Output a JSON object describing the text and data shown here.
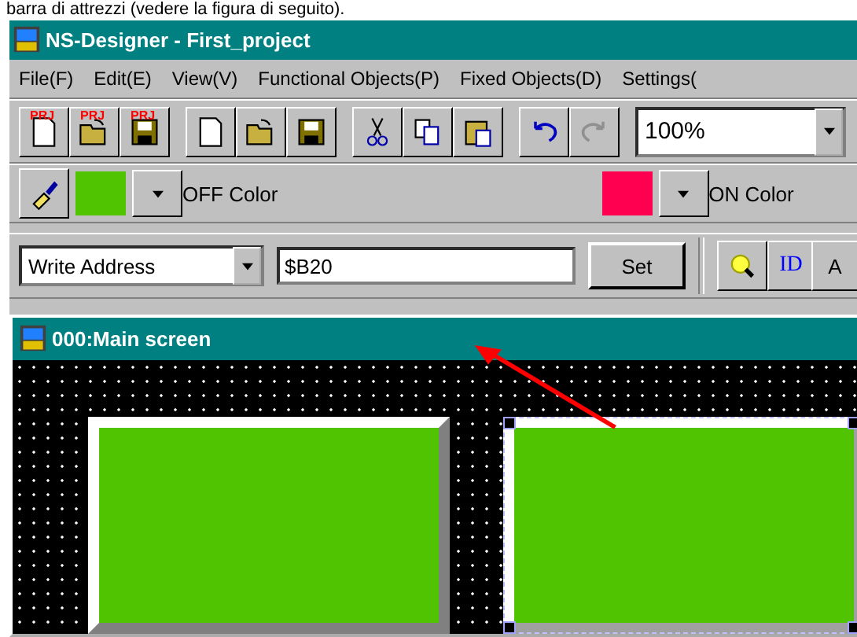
{
  "caption": "barra di attrezzi (vedere la figura di seguito).",
  "window": {
    "title": "NS-Designer - First_project"
  },
  "menu": [
    "File(F)",
    "Edit(E)",
    "View(V)",
    "Functional Objects(P)",
    "Fixed Objects(D)",
    "Settings("
  ],
  "toolbar": {
    "groups": [
      [
        {
          "kind": "prj-new",
          "badge": "PRJ"
        },
        {
          "kind": "prj-open",
          "badge": "PRJ"
        },
        {
          "kind": "prj-save",
          "badge": "PRJ"
        }
      ],
      [
        {
          "kind": "new"
        },
        {
          "kind": "open"
        },
        {
          "kind": "save"
        }
      ],
      [
        {
          "kind": "cut"
        },
        {
          "kind": "copy"
        },
        {
          "kind": "paste"
        }
      ],
      [
        {
          "kind": "undo",
          "disabled": false
        },
        {
          "kind": "redo",
          "disabled": true
        }
      ]
    ],
    "zoom": "100%"
  },
  "color_bar": {
    "off": {
      "label": "OFF Color",
      "color": "#50c400"
    },
    "on": {
      "label": "ON Color",
      "color": "#ff0050"
    }
  },
  "address_bar": {
    "mode": "Write Address",
    "value": "$B20",
    "button": "Set",
    "id_label": "ID",
    "cut_label": "A"
  },
  "screen": {
    "title": "000:Main screen",
    "objects": [
      {
        "selected": false
      },
      {
        "selected": true
      }
    ]
  }
}
